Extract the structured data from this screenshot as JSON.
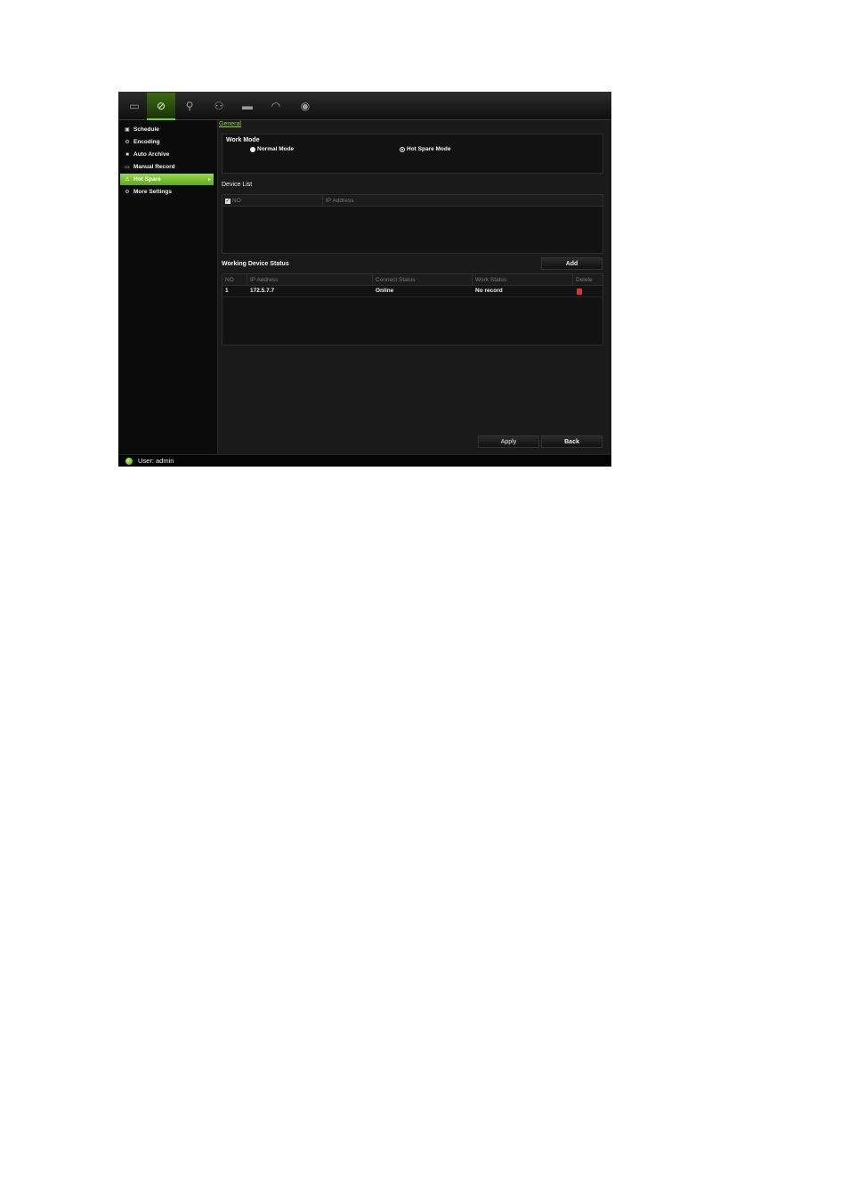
{
  "toolbar": {
    "icons": [
      {
        "name": "monitor-icon",
        "glyph": "▭"
      },
      {
        "name": "recording-icon",
        "glyph": "⊘"
      },
      {
        "name": "network-icon",
        "glyph": "⚲"
      },
      {
        "name": "user-icon",
        "glyph": "⚇"
      },
      {
        "name": "device-icon",
        "glyph": "▬"
      },
      {
        "name": "signal-icon",
        "glyph": "◠"
      },
      {
        "name": "system-icon",
        "glyph": "◉"
      }
    ]
  },
  "sidebar": {
    "items": [
      {
        "label": "Schedule",
        "icon": "▣"
      },
      {
        "label": "Encoding",
        "icon": "⚙"
      },
      {
        "label": "Auto Archive",
        "icon": "■"
      },
      {
        "label": "Manual Record",
        "icon": "▭"
      },
      {
        "label": "Hot Spare",
        "icon": "⚠",
        "arrow": "▸"
      },
      {
        "label": "More Settings",
        "icon": "⚙"
      }
    ]
  },
  "main": {
    "tab": "General",
    "work_mode": {
      "title": "Work Mode",
      "options": [
        "Normal Mode",
        "Hot Spare Mode"
      ]
    },
    "device_list": {
      "title": "Device List",
      "columns": [
        "NO",
        "IP Address"
      ],
      "check_glyph": "✓"
    },
    "working_status": {
      "title": "Working Device Status",
      "add_label": "Add",
      "columns": [
        "NO",
        "IP Address",
        "Connect Status",
        "Work Status",
        "Delete"
      ],
      "rows": [
        {
          "no": "1",
          "ip": "172.5.7.7",
          "connect": "Online",
          "work": "No record"
        }
      ]
    },
    "apply_label": "Apply",
    "back_label": "Back"
  },
  "status": {
    "user_text": "User: admin"
  },
  "colors": {
    "accent": "#7fd12a",
    "delete": "#d23a2a"
  }
}
